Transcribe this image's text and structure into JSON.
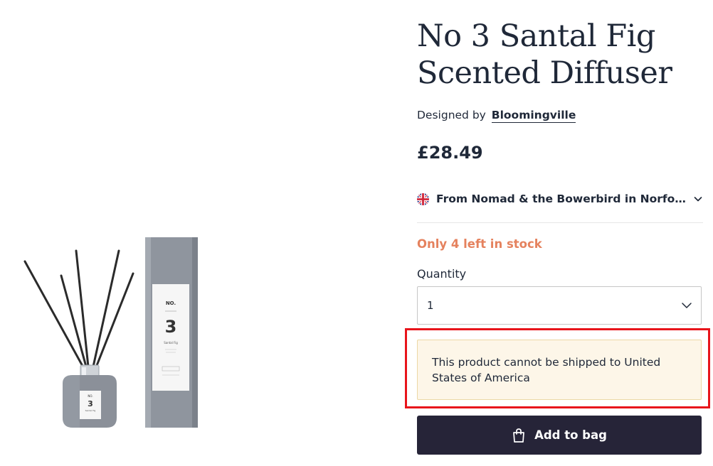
{
  "product": {
    "title": "No 3 Santal Fig Scented Diffuser",
    "designed_by_prefix": "Designed by",
    "designer": "Bloomingville",
    "price": "£28.49",
    "shipper": {
      "flag_icon": "uk-flag-icon",
      "text": "From Nomad & the Bowerbird in Norfolk, …"
    },
    "stock_message": "Only 4 left in stock",
    "stock_color": "#e5825e",
    "quantity": {
      "label": "Quantity",
      "selected": "1"
    },
    "shipping_notice": "This product cannot be shipped to United States of America",
    "add_to_bag_label": "Add to bag",
    "image_label": {
      "brand": "NO.",
      "number": "3",
      "scent": "Santal Fig"
    }
  },
  "colors": {
    "text": "#1f2838",
    "button_bg": "#262438",
    "notice_bg": "#fdf6e8",
    "notice_border": "#ecd8a5",
    "highlight": "#e8141b"
  }
}
